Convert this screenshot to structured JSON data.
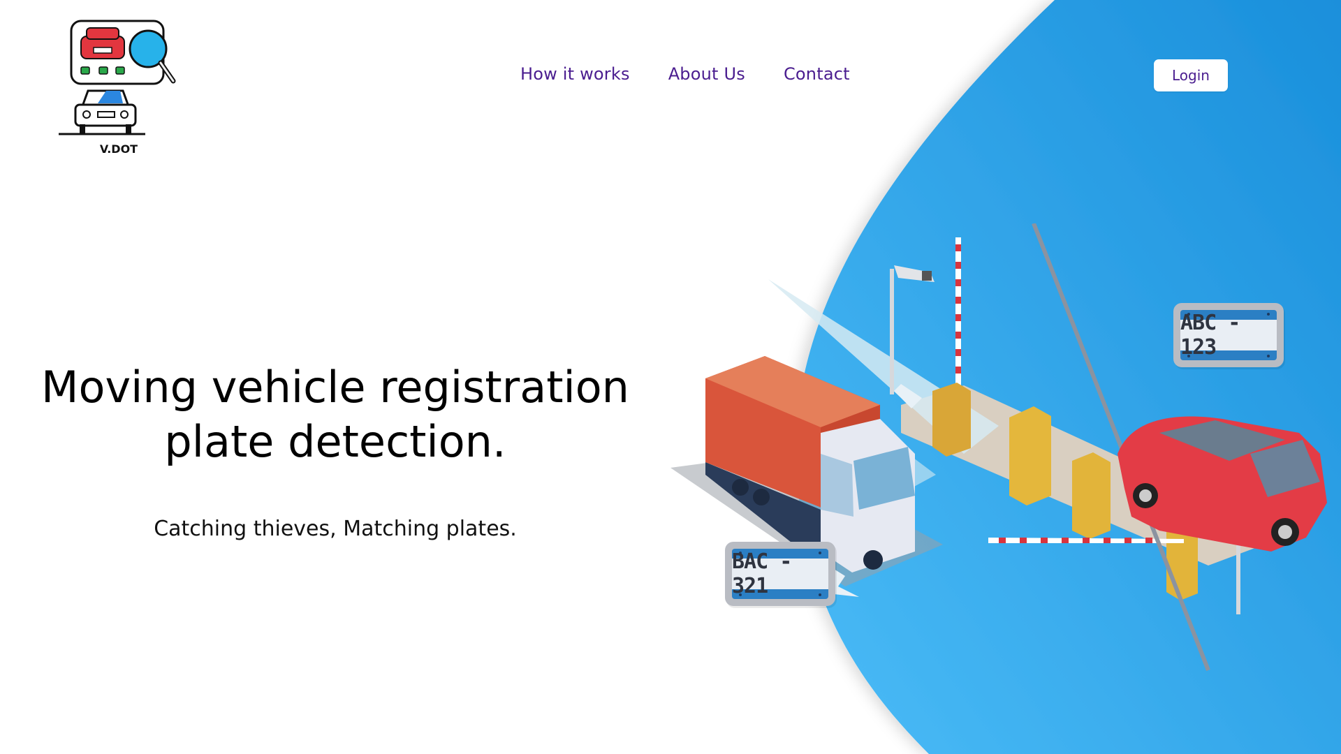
{
  "brand": {
    "name": "V.DOT"
  },
  "nav": {
    "items": [
      "How it works",
      "About Us",
      "Contact"
    ]
  },
  "login": {
    "label": "Login"
  },
  "hero": {
    "title_line1": "Moving vehicle registration",
    "title_line2": "plate detection.",
    "subtitle": "Catching thieves, Matching plates."
  },
  "plates": {
    "front": "ABC - 123",
    "back": "BAC - 321"
  },
  "colors": {
    "accent_blue": "#2ea0ea",
    "nav_text": "#4a1d8f",
    "plate_blue": "#2b7fc4"
  }
}
